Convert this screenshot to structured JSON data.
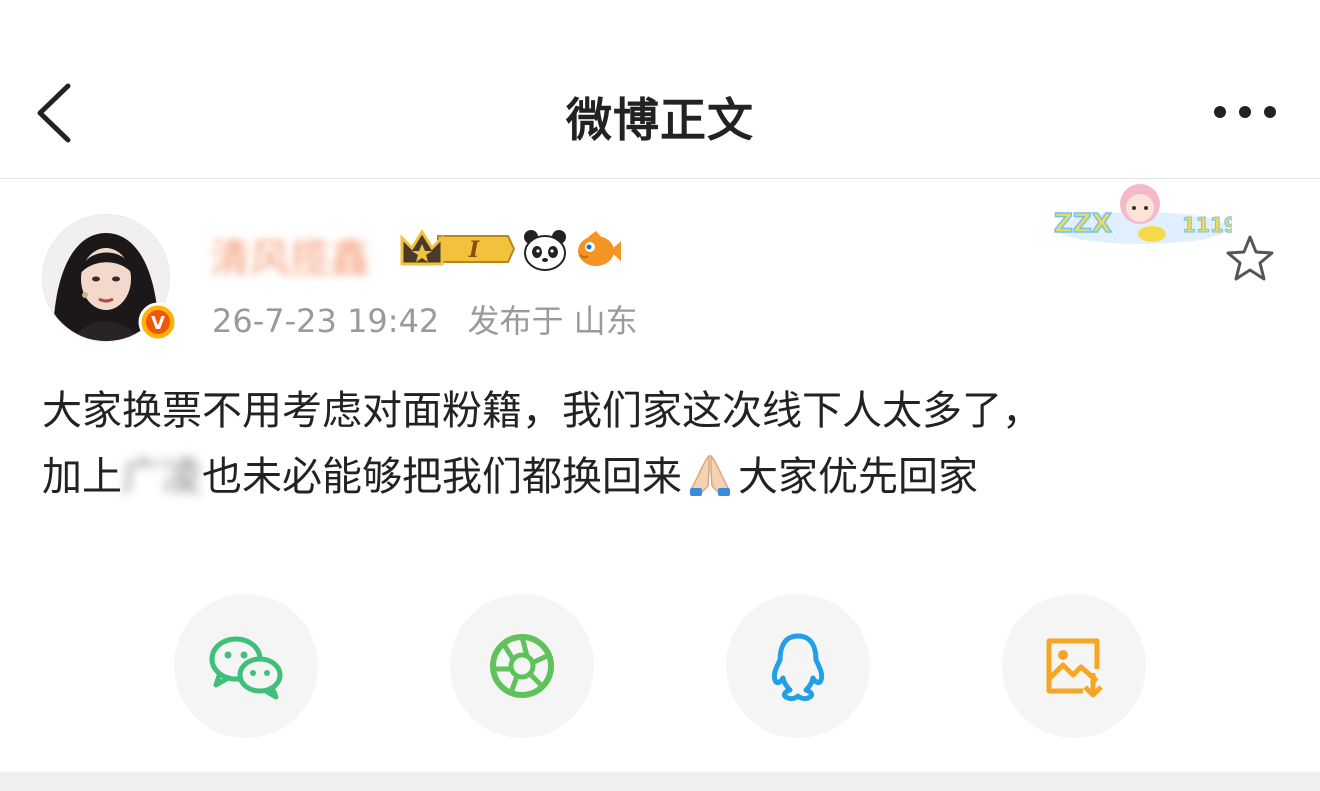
{
  "header": {
    "title": "微博正文",
    "back_icon": "chevron-left-icon",
    "more_icon": "more-dots-icon"
  },
  "post": {
    "username": "清风揽鑫",
    "timestamp": "26-7-23 19:42",
    "location": "发布于 山东",
    "badges": [
      "crown-level-badge",
      "panda-icon",
      "fish-icon"
    ],
    "level_label": "I",
    "sticker_text": "ZZX 1119",
    "content_line1": "大家换票不用考虑对面粉籍，我们家这次线下人太多了，",
    "content_line2_a": "加上",
    "content_line2_blur": "广凌",
    "content_line2_b": "也未必能够把我们都换回来",
    "content_line2_c": "大家优先回家"
  },
  "share": {
    "items": [
      {
        "name": "wechat",
        "color": "#3fc07a"
      },
      {
        "name": "moments",
        "color": "#5fc25b"
      },
      {
        "name": "qq",
        "color": "#22a0e6"
      },
      {
        "name": "save-image",
        "color": "#f5a623"
      }
    ]
  }
}
